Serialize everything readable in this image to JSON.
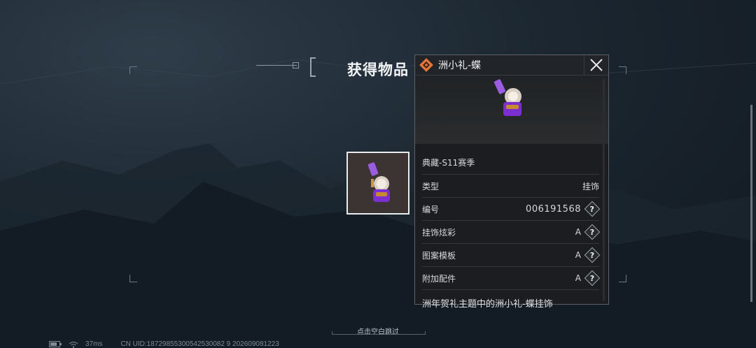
{
  "title": "获得物品",
  "item": {
    "name": "洲小礼-蝶",
    "rarity_color": "#e0763a",
    "details": [
      {
        "label": "典藏-S11赛季",
        "value": ""
      },
      {
        "label": "类型",
        "value": "挂饰"
      },
      {
        "label": "编号",
        "value": "006191568",
        "help": true
      },
      {
        "label": "挂饰炫彩",
        "value": "A",
        "help": true
      },
      {
        "label": "图案模板",
        "value": "A",
        "help": true
      },
      {
        "label": "附加配件",
        "value": "A",
        "help": true
      }
    ],
    "description": "洲年贺礼主题中的洲小礼-蝶挂饰"
  },
  "help_glyph": "?",
  "footer": {
    "skip_hint": "点击空白跳过",
    "ping": "37ms",
    "uid": "CN UID:18729855300542530082 9 202609081223"
  },
  "icons": {
    "close": "close-icon",
    "rarity": "rarity-diamond-icon",
    "battery": "battery-icon",
    "wifi": "wifi-icon"
  }
}
